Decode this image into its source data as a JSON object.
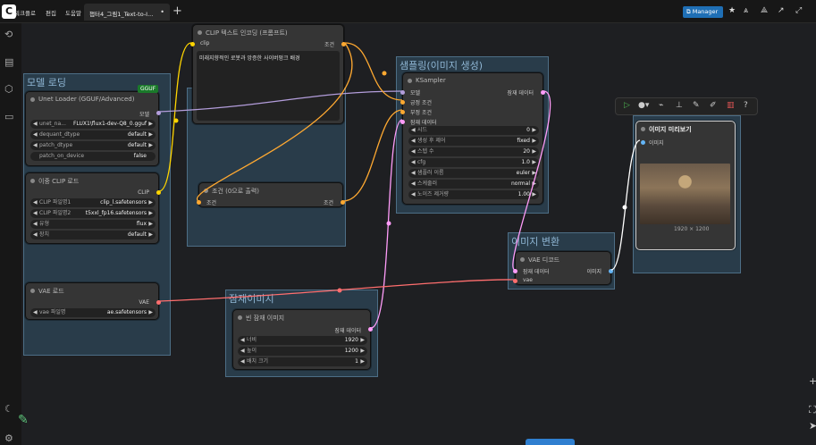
{
  "topbar": {
    "logo": "C",
    "menu": [
      "워크플로",
      "편집",
      "도움말"
    ],
    "tab_label": "챕터4_그림1_Text-to-I...",
    "tab_dot": "•",
    "tab_add": "+",
    "manager_label": "Manager"
  },
  "groups": {
    "model_loading": "모델 로딩",
    "sampling": "샘플링(이미지 생성)",
    "image_convert": "이미지 변환",
    "latent": "잠재이미지"
  },
  "nodes": {
    "unet": {
      "title": "Unet Loader (GGUF/Advanced)",
      "badge": "GGUF",
      "output": "모델",
      "widgets": [
        {
          "label": "unet_na...",
          "value": "FLUX1\\flux1-dev-Q8_0.gguf"
        },
        {
          "label": "dequant_dtype",
          "value": "default"
        },
        {
          "label": "patch_dtype",
          "value": "default"
        },
        {
          "label": "patch_on_device",
          "value": "false"
        }
      ]
    },
    "dual_clip": {
      "title": "이중 CLIP 로드",
      "output": "CLIP",
      "widgets": [
        {
          "label": "CLIP 파일명1",
          "value": "clip_l.safetensors"
        },
        {
          "label": "CLIP 파일명2",
          "value": "t5xxl_fp16.safetensors"
        },
        {
          "label": "유형",
          "value": "flux"
        },
        {
          "label": "장치",
          "value": "default"
        }
      ]
    },
    "vae_loader": {
      "title": "VAE 로드",
      "output": "VAE",
      "widgets": [
        {
          "label": "vae 파일명",
          "value": "ae.safetensors"
        }
      ]
    },
    "clip_text": {
      "title": "CLIP 텍스트 인코딩 (프롬프트)",
      "input": "clip",
      "output": "조건",
      "text": "미래지향적인 로봇과 앙증한 사이버펑크 배경"
    },
    "zero_cond": {
      "title": "조건 (0으로 출력)",
      "input": "조건",
      "output": "조건"
    },
    "ksampler": {
      "title": "KSampler",
      "inputs": [
        "모델",
        "긍정 조건",
        "부정 조건",
        "잠재 데이터"
      ],
      "output": "잠재 데이터",
      "widgets": [
        {
          "label": "시드",
          "value": "0"
        },
        {
          "label": "생성 후 제어",
          "value": "fixed"
        },
        {
          "label": "스텝 수",
          "value": "20"
        },
        {
          "label": "cfg",
          "value": "1.0"
        },
        {
          "label": "샘플러 이름",
          "value": "euler"
        },
        {
          "label": "스케줄러",
          "value": "normal"
        },
        {
          "label": "노이즈 제거량",
          "value": "1.00"
        }
      ]
    },
    "vae_decode": {
      "title": "VAE 디코드",
      "inputs": [
        "잠재 데이터",
        "vae"
      ],
      "output": "이미지"
    },
    "empty_latent": {
      "title": "빈 잠재 이미지",
      "output": "잠재 데이터",
      "widgets": [
        {
          "label": "너비",
          "value": "1920"
        },
        {
          "label": "높이",
          "value": "1200"
        },
        {
          "label": "배치 크기",
          "value": "1"
        }
      ]
    },
    "preview": {
      "title": "이미지 미리보기",
      "input": "이미지",
      "caption": "1920 × 1200"
    }
  },
  "colors": {
    "model": "#b39ddb",
    "clip": "#ffd500",
    "conditioning": "#ffa931",
    "latent": "#ff9cf9",
    "vae": "#ff6e6e",
    "image": "#64b5f6",
    "group": "#3a6a8c"
  },
  "icons": {
    "sidebar": [
      "history-icon",
      "book-icon",
      "cube-icon",
      "folder-icon",
      "moon-icon",
      "gear-icon"
    ],
    "toolbar": [
      "play-icon",
      "circle-color-icon",
      "wand-icon",
      "pin-icon",
      "edit-icon",
      "pencil-icon",
      "trash-icon",
      "help-icon"
    ]
  }
}
